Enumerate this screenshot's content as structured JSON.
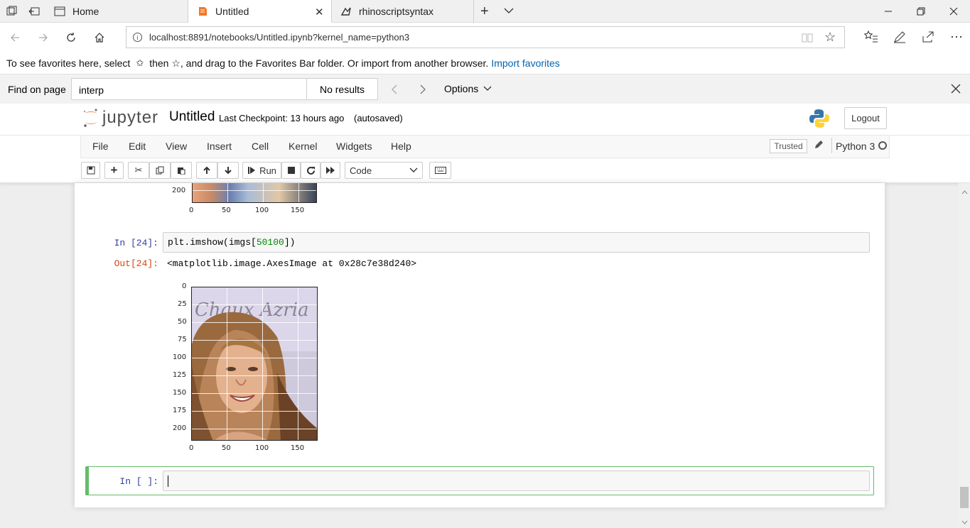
{
  "browser": {
    "tabs": [
      {
        "title": "Home",
        "icon": "page-icon",
        "active": false
      },
      {
        "title": "Untitled",
        "icon": "jupyter-tab-icon",
        "active": true
      },
      {
        "title": "rhinoscriptsyntax",
        "icon": "rhino-icon",
        "active": false
      }
    ],
    "url": "localhost:8891/notebooks/Untitled.ipynb?kernel_name=python3",
    "favorites_hint": "To see favorites here, select",
    "favorites_hint2": "then ☆, and drag to the Favorites Bar folder. Or import from another browser.",
    "favorites_link": "Import favorites",
    "find": {
      "label": "Find on page",
      "query": "interp",
      "results": "No results",
      "options": "Options"
    }
  },
  "jupyter": {
    "logo_text": "jupyter",
    "notebook_name": "Untitled",
    "checkpoint": "Last Checkpoint: 13 hours ago",
    "autosave": "(autosaved)",
    "logout": "Logout",
    "menu": [
      "File",
      "Edit",
      "View",
      "Insert",
      "Cell",
      "Kernel",
      "Widgets",
      "Help"
    ],
    "trusted": "Trusted",
    "kernel": "Python 3",
    "run_label": "Run",
    "cell_type": "Code"
  },
  "cells": {
    "prev_axis": {
      "y_tick": "200",
      "x_ticks": [
        "0",
        "50",
        "100",
        "150"
      ]
    },
    "cell24": {
      "in_prompt": "In [24]:",
      "code_fn": "plt.imshow",
      "code_open": "(imgs[",
      "code_num": "50100",
      "code_close": "])",
      "out_prompt": "Out[24]:",
      "output": "<matplotlib.image.AxesImage at 0x28c7e38d240>",
      "y_ticks": [
        "0",
        "25",
        "50",
        "75",
        "100",
        "125",
        "150",
        "175",
        "200"
      ],
      "x_ticks": [
        "0",
        "50",
        "100",
        "150"
      ],
      "watermark": "Chaux Azria"
    },
    "empty_cell": {
      "in_prompt": "In [ ]:"
    }
  },
  "colors": {
    "prompt_in": "#303f9f",
    "prompt_out": "#d84315",
    "selected_cell_border": "#66bb6a",
    "link": "#0063b1"
  }
}
